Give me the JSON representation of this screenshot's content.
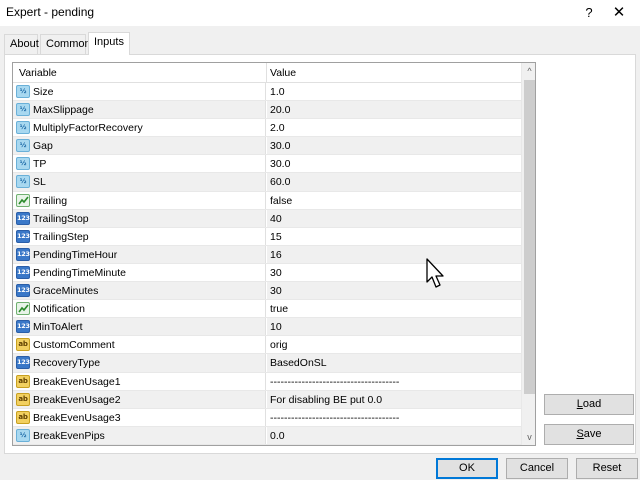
{
  "window": {
    "title": "Expert - pending",
    "help_label": "?",
    "close_label": "✕"
  },
  "tabs": [
    {
      "label": "About"
    },
    {
      "label": "Common"
    },
    {
      "label": "Inputs",
      "active": true
    }
  ],
  "grid": {
    "columns": {
      "variable": "Variable",
      "value": "Value"
    },
    "rows": [
      {
        "icon": "double-type-icon",
        "name": "Size",
        "value": "1.0"
      },
      {
        "icon": "double-type-icon",
        "name": "MaxSlippage",
        "value": "20.0"
      },
      {
        "icon": "double-type-icon",
        "name": "MultiplyFactorRecovery",
        "value": "2.0"
      },
      {
        "icon": "double-type-icon",
        "name": "Gap",
        "value": "30.0"
      },
      {
        "icon": "double-type-icon",
        "name": "TP",
        "value": "30.0"
      },
      {
        "icon": "double-type-icon",
        "name": "SL",
        "value": "60.0"
      },
      {
        "icon": "bool-type-icon",
        "name": "Trailing",
        "value": "false"
      },
      {
        "icon": "int-type-icon",
        "name": "TrailingStop",
        "value": "40"
      },
      {
        "icon": "int-type-icon",
        "name": "TrailingStep",
        "value": "15"
      },
      {
        "icon": "int-type-icon",
        "name": "PendingTimeHour",
        "value": "16"
      },
      {
        "icon": "int-type-icon",
        "name": "PendingTimeMinute",
        "value": "30"
      },
      {
        "icon": "int-type-icon",
        "name": "GraceMinutes",
        "value": "30"
      },
      {
        "icon": "bool-type-icon",
        "name": "Notification",
        "value": "true"
      },
      {
        "icon": "int-type-icon",
        "name": "MinToAlert",
        "value": "10"
      },
      {
        "icon": "string-type-icon",
        "name": "CustomComment",
        "value": "orig"
      },
      {
        "icon": "int-type-icon",
        "name": "RecoveryType",
        "value": "BasedOnSL"
      },
      {
        "icon": "string-type-icon",
        "name": "BreakEvenUsage1",
        "value": "-------------------------------------"
      },
      {
        "icon": "string-type-icon",
        "name": "BreakEvenUsage2",
        "value": "For disabling BE put 0.0"
      },
      {
        "icon": "string-type-icon",
        "name": "BreakEvenUsage3",
        "value": "-------------------------------------"
      },
      {
        "icon": "double-type-icon",
        "name": "BreakEvenPips",
        "value": "0.0"
      }
    ],
    "icon_labels": {
      "double": "½",
      "int": "123",
      "string": "ab"
    },
    "scroll_up": "^",
    "scroll_down": "v"
  },
  "side_buttons": {
    "load": {
      "key": "L",
      "rest": "oad"
    },
    "save": {
      "key": "S",
      "rest": "ave"
    }
  },
  "footer": {
    "ok_label": "OK",
    "cancel_label": "Cancel",
    "reset_label": "Reset"
  },
  "colors": {
    "accent": "#0078d7",
    "alt_row": "#f0f0f0",
    "int_icon": "#3a78c8",
    "double_icon": "#a8d8f0",
    "string_icon": "#f2d060"
  }
}
